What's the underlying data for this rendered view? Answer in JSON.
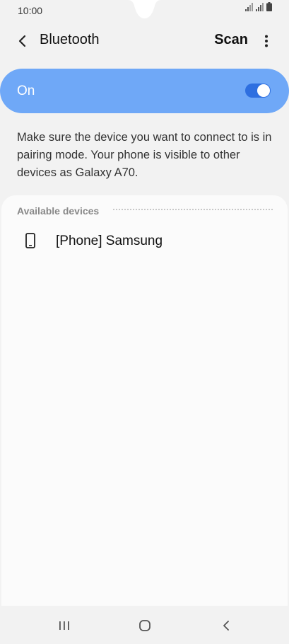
{
  "status_bar": {
    "time": "10:00",
    "icons": [
      "signal-icon",
      "signal-icon",
      "battery-icon"
    ]
  },
  "app_bar": {
    "title": "Bluetooth",
    "scan_label": "Scan",
    "back_icon": "back-arrow-icon",
    "more_icon": "more-options-icon"
  },
  "bluetooth_toggle": {
    "label": "On",
    "state": true,
    "card_color": "#6fa8f7",
    "switch_color": "#2e6fe0"
  },
  "info": {
    "text": "Make sure the device you want to connect to is in pairing mode. Your phone is visible to other devices as Galaxy A70."
  },
  "available_devices": {
    "header": "Available devices",
    "items": [
      {
        "name": "[Phone] Samsung",
        "icon": "phone-icon"
      }
    ]
  },
  "nav_bar": {
    "recents_icon": "recents-icon",
    "home_icon": "home-icon",
    "back_icon": "nav-back-icon"
  }
}
